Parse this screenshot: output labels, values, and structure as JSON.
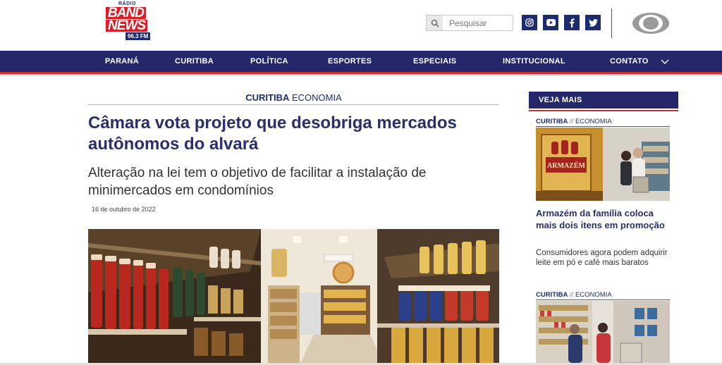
{
  "logo": {
    "small": "RÁDIO",
    "line1": "BAND",
    "line2": "NEWS",
    "freq": "96.3 FM"
  },
  "search": {
    "placeholder": "Pesquisar",
    "icon": "search-icon"
  },
  "social": [
    {
      "name": "instagram-icon",
      "glyph": "◎"
    },
    {
      "name": "youtube-icon",
      "glyph": "▶"
    },
    {
      "name": "facebook-icon",
      "glyph": "f"
    },
    {
      "name": "twitter-icon",
      "glyph": "✦"
    }
  ],
  "nav": {
    "items": [
      "PARANÁ",
      "CURITIBA",
      "POLÍTICA",
      "ESPORTES",
      "ESPECIAIS",
      "INSTITUCIONAL",
      "CONTATO"
    ],
    "chevron": "chevron-down-icon"
  },
  "article": {
    "category_main": "CURITIBA",
    "category_sub": "ECONOMIA",
    "title": "Câmara vota projeto que desobriga mercados autônomos do alvará",
    "subtitle": "Alteração na lei tem o objetivo de facilitar a instalação de minimercados em condomínios",
    "date": "16 de outubro de 2022"
  },
  "sidebar": {
    "heading": "VEJA MAIS",
    "items": [
      {
        "category_main": "CURITIBA",
        "separator": "//",
        "category_sub": "ECONOMIA",
        "sign_text": "ARMAZÉM",
        "title": "Armazém da família coloca mais dois itens em promoção",
        "description": "Consumidores agora podem adquirir leite em pó e café mais baratos"
      },
      {
        "category_main": "CURITIBA",
        "separator": "//",
        "category_sub": "ECONOMIA"
      }
    ]
  },
  "colors": {
    "navy": "#24286b",
    "red": "#c92a2a",
    "title": "#2a2e6e"
  }
}
